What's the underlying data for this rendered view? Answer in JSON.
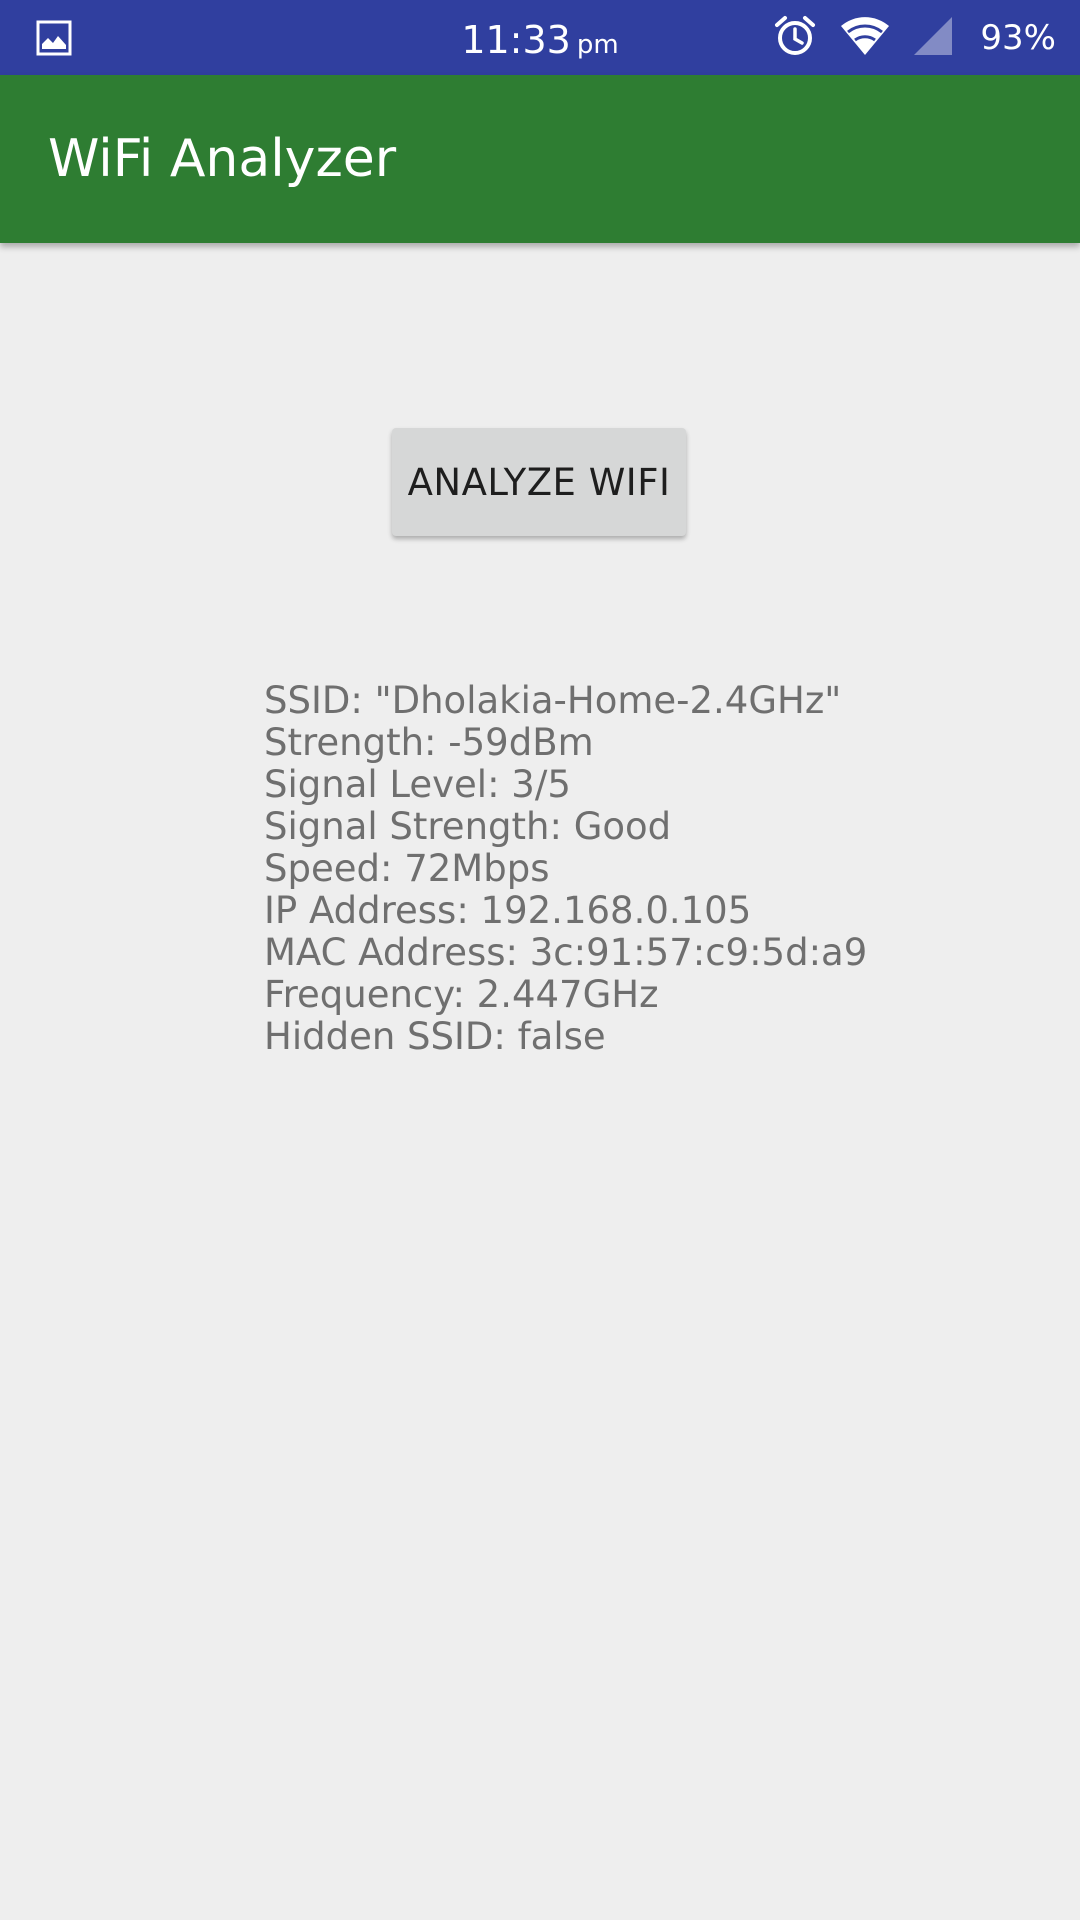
{
  "status_bar": {
    "time": "11:33",
    "ampm": "pm",
    "battery": "93%",
    "icons": {
      "left": "image-notification-icon",
      "alarm": "alarm-clock-icon",
      "wifi": "wifi-icon",
      "cell": "cell-signal-icon"
    },
    "colors": {
      "background": "#303f9f"
    }
  },
  "app_bar": {
    "title": "WiFi Analyzer",
    "colors": {
      "background": "#2e7d32"
    }
  },
  "main": {
    "analyze_button_label": "ANALYZE WIFI",
    "info": [
      "SSID: \"Dholakia-Home-2.4GHz\"",
      "Strength: -59dBm",
      "Signal Level: 3/5",
      "Signal Strength: Good",
      "Speed: 72Mbps",
      "IP Address: 192.168.0.105",
      "MAC Address: 3c:91:57:c9:5d:a9",
      "Frequency: 2.447GHz",
      "Hidden SSID: false"
    ]
  }
}
